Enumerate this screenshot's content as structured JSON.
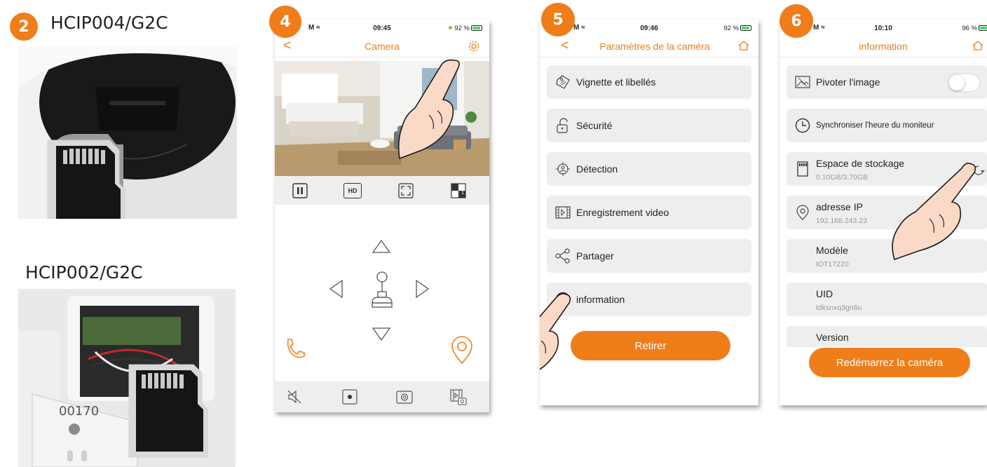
{
  "steps": [
    "2",
    "4",
    "5",
    "6"
  ],
  "products": {
    "model_a": "HCIP004/G2C",
    "model_b": "HCIP002/G2C",
    "photo_text": "00170"
  },
  "screen4": {
    "time": "09:45",
    "battery": "92 %",
    "title": "Camera",
    "back": "<",
    "hd_label": "HD",
    "split_num": "1"
  },
  "screen5": {
    "time": "09:46",
    "battery": "92 %",
    "title": "Paramètres de la caméra",
    "back": "<",
    "items": [
      {
        "label": "Vignette et libellés",
        "icon": "tag-icon"
      },
      {
        "label": "Sécurité",
        "icon": "lock-icon"
      },
      {
        "label": "Détection",
        "icon": "detection-icon"
      },
      {
        "label": "Enregistrement video",
        "icon": "film-icon"
      },
      {
        "label": "Partager",
        "icon": "share-icon"
      },
      {
        "label": "information",
        "icon": "info-icon"
      }
    ],
    "button": "Retirer"
  },
  "screen6": {
    "time": "10:10",
    "battery": "96 %",
    "title": "information",
    "items": [
      {
        "label": "Pivoter l'image",
        "value": ""
      },
      {
        "label": "Synchroniser l'heure du moniteur",
        "value": ""
      },
      {
        "label": "Espace de stockage",
        "value": "0.10GB/3.70GB"
      },
      {
        "label": "adresse IP",
        "value": "192.168.243.23"
      },
      {
        "label": "Modèle",
        "value": "IOT17220"
      },
      {
        "label": "UID",
        "value": "tdksnxq3gn6u"
      },
      {
        "label": "Version",
        "value": ""
      }
    ],
    "button": "Redémarrez la caméra"
  },
  "colors": {
    "accent": "#ef7d1a",
    "panel": "#eeeeee"
  }
}
